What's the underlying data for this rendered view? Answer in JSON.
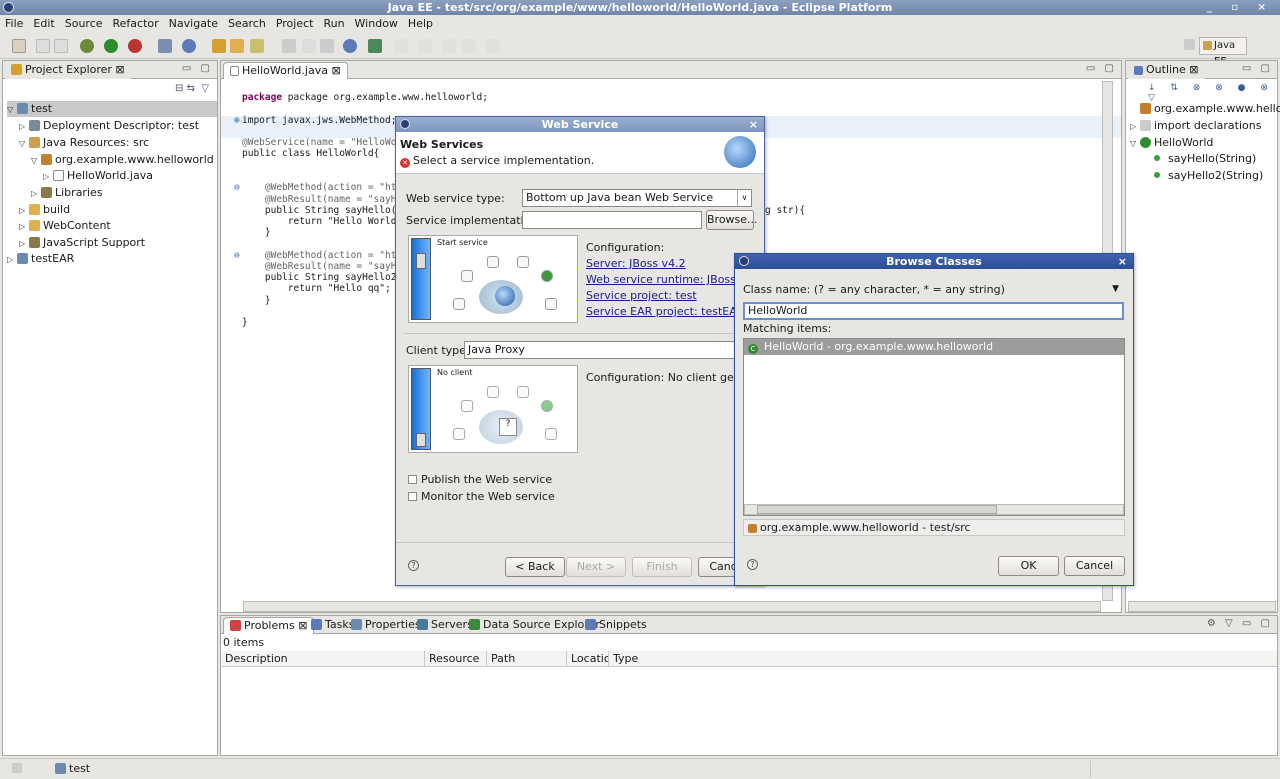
{
  "window": {
    "title": "Java EE - test/src/org/example/www/helloworld/HelloWorld.java - Eclipse Platform",
    "controls": "_ ▫ ×"
  },
  "menu": [
    "File",
    "Edit",
    "Source",
    "Refactor",
    "Navigate",
    "Search",
    "Project",
    "Run",
    "Window",
    "Help"
  ],
  "perspective": "Java EE",
  "project_explorer": {
    "tab": "Project Explorer",
    "items": [
      {
        "label": "test",
        "level": 0,
        "twisty": "▽"
      },
      {
        "label": "Deployment Descriptor: test",
        "level": 1,
        "twisty": "▷"
      },
      {
        "label": "Java Resources: src",
        "level": 1,
        "twisty": "▽"
      },
      {
        "label": "org.example.www.helloworld",
        "level": 2,
        "twisty": "▽"
      },
      {
        "label": "HelloWorld.java",
        "level": 3,
        "twisty": "▷"
      },
      {
        "label": "Libraries",
        "level": 2,
        "twisty": "▷"
      },
      {
        "label": "build",
        "level": 1,
        "twisty": "▷"
      },
      {
        "label": "WebContent",
        "level": 1,
        "twisty": "▷"
      },
      {
        "label": "JavaScript Support",
        "level": 1,
        "twisty": "▷"
      },
      {
        "label": "testEAR",
        "level": 0,
        "twisty": "▷"
      }
    ]
  },
  "editor": {
    "tab": "HelloWorld.java",
    "lines": [
      "package org.example.www.helloworld;",
      "",
      "import javax.jws.WebMethod;",
      "",
      "@WebService(name = \"HelloWorl",
      "public class HelloWorld{",
      "",
      "",
      "    @WebMethod(action = \"http",
      "    @WebResult(name = \"sayHel",
      "    public String sayHello(@W",
      "        return \"Hello World\";",
      "    }",
      "",
      "    @WebMethod(action = \"http",
      "    @WebResult(name = \"sayHel",
      "    public String sayHello2(",
      "        return \"Hello qq\";",
      "    }",
      "",
      "}"
    ],
    "overflow_text": "g str){"
  },
  "outline": {
    "tab": "Outline",
    "items": [
      {
        "label": "org.example.www.hellowor",
        "level": 0
      },
      {
        "label": "import declarations",
        "level": 0
      },
      {
        "label": "HelloWorld",
        "level": 0
      },
      {
        "label": "sayHello(String)",
        "level": 1
      },
      {
        "label": "sayHello2(String)",
        "level": 1
      }
    ]
  },
  "web_service_dialog": {
    "title": "Web Service",
    "heading": "Web Services",
    "message": "Select a service implementation.",
    "ws_type_label": "Web service type:",
    "ws_type_value": "Bottom up Java bean Web Service",
    "impl_label": "Service implementation:",
    "impl_value": "",
    "browse": "Browse...",
    "service_slider_label": "Start service",
    "config_label": "Configuration:",
    "links": [
      "Server: JBoss v4.2",
      "Web service runtime: JBossWS",
      "Service project: test",
      "Service EAR project: testEAR"
    ],
    "client_type_label": "Client type:",
    "client_type_value": "Java Proxy",
    "client_slider_label": "No client",
    "client_config": "Configuration: No client generatio",
    "publish": "Publish the Web service",
    "monitor": "Monitor the Web service",
    "buttons": {
      "back": "< Back",
      "next": "Next >",
      "finish": "Finish",
      "cancel": "Cancel"
    }
  },
  "browse_dialog": {
    "title": "Browse Classes",
    "class_name_label": "Class name: (? = any character, * = any string)",
    "search_value": "HelloWorld",
    "matching_label": "Matching items:",
    "matches": [
      "HelloWorld - org.example.www.helloworld"
    ],
    "package": "org.example.www.helloworld - test/src",
    "ok": "OK",
    "cancel": "Cancel"
  },
  "bottom_panel": {
    "tabs": [
      "Problems",
      "Tasks",
      "Properties",
      "Servers",
      "Data Source Explorer",
      "Snippets"
    ],
    "count": "0 items",
    "columns": [
      "Description",
      "Resource",
      "Path",
      "Location",
      "Type"
    ]
  },
  "statusbar": {
    "project": "test"
  }
}
